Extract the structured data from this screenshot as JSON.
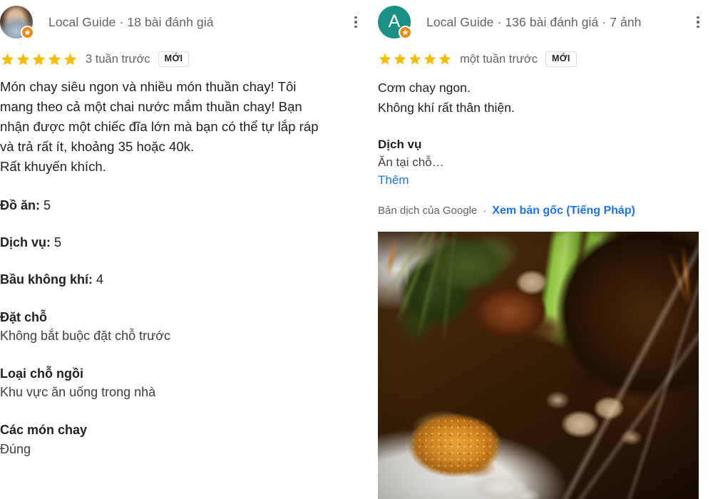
{
  "reviews": [
    {
      "avatar": {
        "type": "photo",
        "letter": "",
        "bg": "#cfcfcf"
      },
      "local_guide_line": "Local Guide · 18 bài đánh giá",
      "rating": 5,
      "time_ago": "3 tuần trước",
      "new_badge": "MỚI",
      "body_lines": [
        "Món chay siêu ngon và nhiều món thuần chay! Tôi",
        "mang theo cả một chai nước mắm thuần chay! Bạn",
        "nhận được một chiếc đĩa lớn mà bạn có thể tự lắp ráp",
        "và trả rất ít, khoảng 35 hoặc 40k.",
        "Rất khuyến khích."
      ],
      "inline_attributes": [
        {
          "key": "Đồ ăn:",
          "value": "5"
        },
        {
          "key": "Dịch vụ:",
          "value": "5"
        },
        {
          "key": "Bầu không khí:",
          "value": "4"
        }
      ],
      "stacked_attributes": [
        {
          "key": "Đặt chỗ",
          "value": "Không bắt buộc đặt chỗ trước"
        },
        {
          "key": "Loại chỗ ngồi",
          "value": "Khu vực ăn uống trong nhà"
        },
        {
          "key": "Các món chay",
          "value": "Đúng"
        }
      ]
    },
    {
      "avatar": {
        "type": "letter",
        "letter": "A",
        "bg": "#1a9184"
      },
      "local_guide_line": "Local Guide · 136 bài đánh giá · 7 ảnh",
      "rating": 5,
      "time_ago": "một tuần trước",
      "new_badge": "MỚI",
      "body_lines": [
        "Cơm chay ngon.",
        "Không khí rất thân thiện."
      ],
      "service_block": {
        "key": "Dịch vụ",
        "value": "Ăn tại chỗ…",
        "more_link": "Thêm"
      },
      "translation": {
        "label": "Bản dịch của Google",
        "separator": "·",
        "link": "Xem bản gốc (Tiếng Pháp)"
      },
      "photo": {
        "alt": "Đĩa cơm chay với rau muống xào, nấm, đậu hũ chiên và sốt nâu"
      }
    }
  ],
  "icons": {
    "overflow": "more-vert-icon",
    "star": "star-filled-icon",
    "local_guide": "local-guide-badge-icon"
  },
  "colors": {
    "star": "#fabb05",
    "link": "#1a73e8",
    "text_primary": "#202124",
    "text_secondary": "#5f6368",
    "badge_border": "#dadce0",
    "local_guide_badge": "#f2870d",
    "avatar_teal": "#1a9184"
  }
}
